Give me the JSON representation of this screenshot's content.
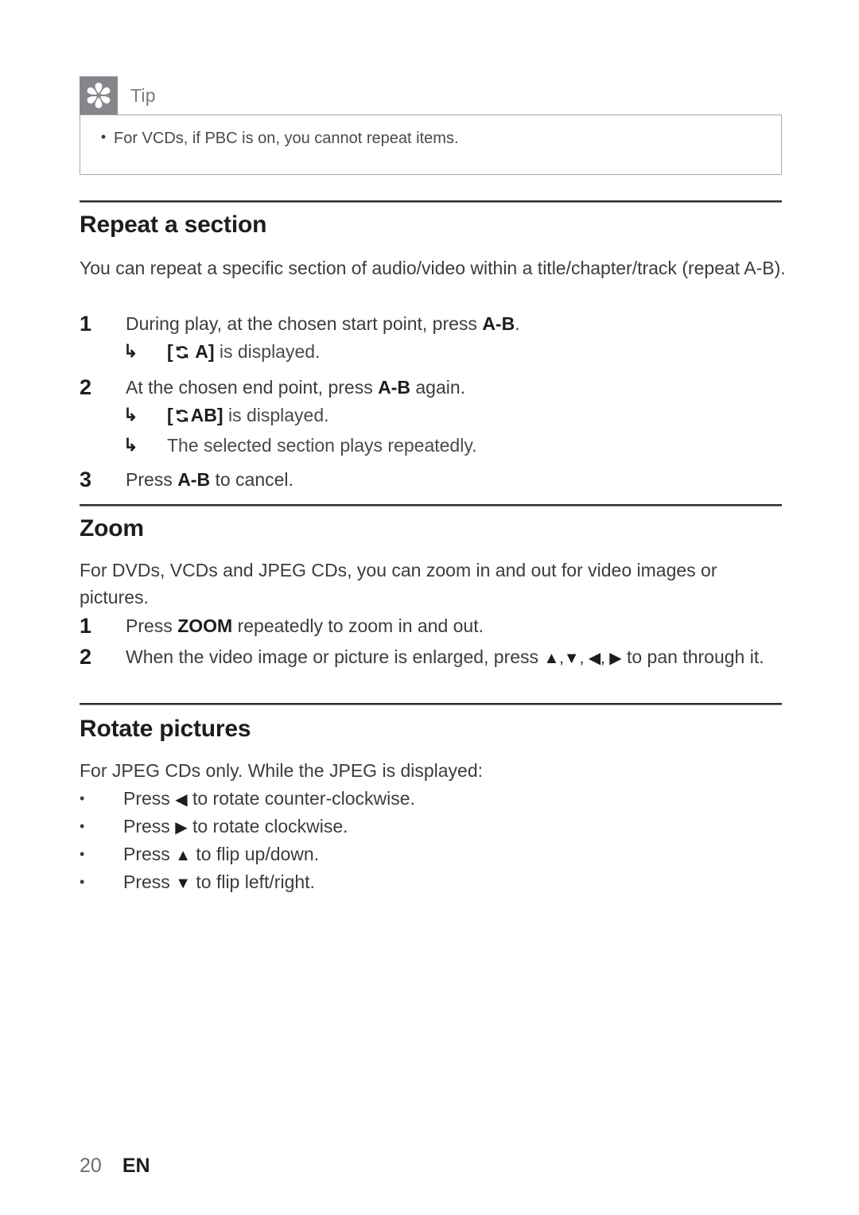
{
  "note": {
    "icon": "tip-starburst-icon",
    "title": "Tip",
    "bullet_glyph": "•",
    "items": [
      "For VCDs, if PBC is on, you cannot repeat items."
    ]
  },
  "sections": [
    {
      "heading": "Repeat a section",
      "intro": "You can repeat a specific section of audio/video within a title/chapter/track (repeat A-B).",
      "steps": [
        {
          "num": "1",
          "before": "During play, at the chosen start point, press ",
          "bold": "A-B",
          "after": "."
        },
        {
          "num": "2",
          "before": "At the chosen end point, press ",
          "bold": "A-B",
          "after": " again."
        },
        {
          "num": "3",
          "before": "Press ",
          "bold": "A-B",
          "after": " to cancel."
        }
      ],
      "sublines": [
        {
          "arrow": "↳",
          "icon": "repeat-icon",
          "bracket_open": "[",
          "label": " A]",
          "rest": " is displayed."
        },
        {
          "arrow": "↳",
          "icon": "repeat-icon",
          "bracket_open": "[",
          "label": "AB]",
          "rest": " is displayed."
        },
        {
          "arrow": "↳",
          "plain": "The selected section plays repeatedly."
        }
      ]
    },
    {
      "heading": "Zoom",
      "intro": "For DVDs, VCDs and JPEG CDs, you can zoom in and out for video images or pictures.",
      "steps": [
        {
          "num": "1",
          "before": "Press ",
          "bold": "ZOOM",
          "after": " repeatedly to zoom in and out."
        },
        {
          "num": "2",
          "before": "When the video image or picture is enlarged, press ",
          "arrows": "▲,▼, ◀, ▶",
          "after": " to pan through it."
        }
      ]
    },
    {
      "heading": "Rotate pictures",
      "intro": "For JPEG CDs only. While the JPEG is displayed:",
      "bullets": [
        {
          "glyph": "•",
          "before": "Press ",
          "arrow": "◀",
          "after": " to rotate counter-clockwise."
        },
        {
          "glyph": "•",
          "before": "Press ",
          "arrow": "▶",
          "after": " to rotate clockwise."
        },
        {
          "glyph": "•",
          "before": "Press ",
          "arrow": "▲",
          "after": " to flip up/down."
        },
        {
          "glyph": "•",
          "before": "Press ",
          "arrow": "▼",
          "after": " to flip left/right."
        }
      ]
    }
  ],
  "footer": {
    "page_number": "20",
    "language": "EN"
  },
  "colors": {
    "note_icon_bg": "#86868c",
    "note_border": "#a9a9ae",
    "rule": "#2e2e2e",
    "heading": "#1d1d1d",
    "body": "#3c3c3c",
    "muted": "#7a7a80"
  }
}
